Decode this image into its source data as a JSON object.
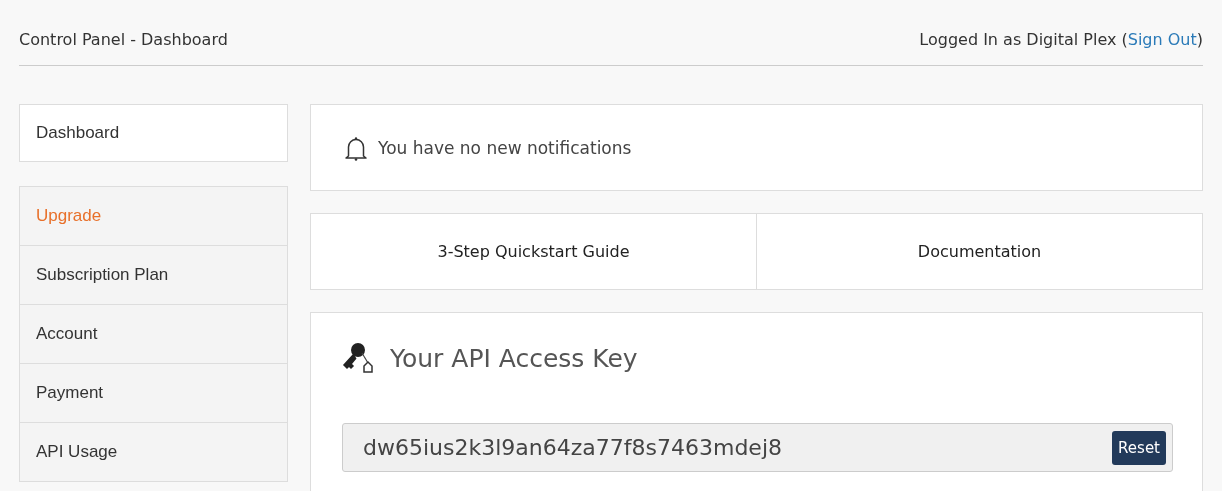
{
  "header": {
    "title": "Control Panel - Dashboard",
    "user_prefix": "Logged In as Digital Plex (",
    "sign_out": "Sign Out",
    "user_suffix": ")"
  },
  "sidebar": {
    "top_item": {
      "label": "Dashboard"
    },
    "items": [
      {
        "label": "Upgrade",
        "kind": "accent"
      },
      {
        "label": "Subscription Plan",
        "kind": "normal"
      },
      {
        "label": "Account",
        "kind": "normal"
      },
      {
        "label": "Payment",
        "kind": "normal"
      },
      {
        "label": "API Usage",
        "kind": "normal"
      }
    ]
  },
  "notification": {
    "text": "You have no new notifications"
  },
  "links": [
    {
      "label": "3-Step Quickstart Guide"
    },
    {
      "label": "Documentation"
    }
  ],
  "api_key": {
    "title": "Your API Access Key",
    "value": "dw65ius2k3l9an64za77f8s7463mdej8",
    "button": "Reset"
  }
}
